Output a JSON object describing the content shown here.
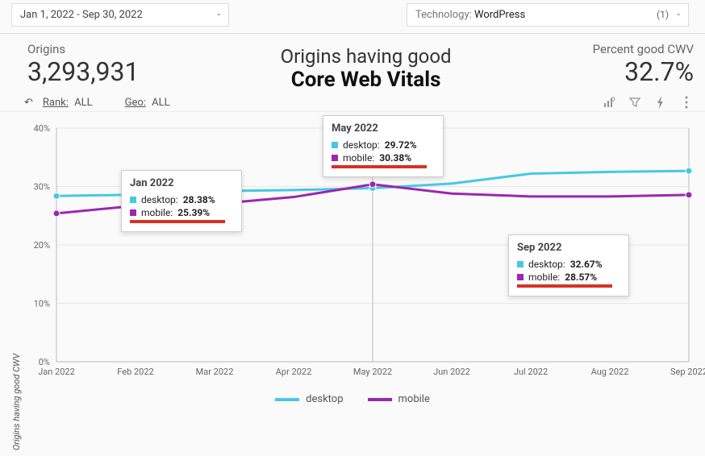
{
  "filters": {
    "date_range": "Jan 1, 2022 - Sep 30, 2022",
    "tech_label": "Technology",
    "tech_value": "WordPress",
    "tech_count": "(1)"
  },
  "header": {
    "origins_label": "Origins",
    "origins_value": "3,293,931",
    "title_line1": "Origins having good",
    "title_line2": "Core Web Vitals",
    "pct_label": "Percent good CWV",
    "pct_value": "32.7%"
  },
  "toolbar": {
    "rank_label": "Rank:",
    "rank_value": "ALL",
    "geo_label": "Geo:",
    "geo_value": "ALL"
  },
  "chart_data": {
    "type": "line",
    "xlabel": "",
    "ylabel": "Origins having good CWV",
    "ylim": [
      0,
      40
    ],
    "yticks": [
      "0%",
      "10%",
      "20%",
      "30%",
      "40%"
    ],
    "categories": [
      "Jan 2022",
      "Feb 2022",
      "Mar 2022",
      "Apr 2022",
      "May 2022",
      "Jun 2022",
      "Jul 2022",
      "Aug 2022",
      "Sep 2022"
    ],
    "series": [
      {
        "name": "desktop",
        "color": "#46c8e4",
        "values": [
          28.38,
          28.6,
          29.2,
          29.4,
          29.72,
          30.5,
          32.2,
          32.5,
          32.67
        ]
      },
      {
        "name": "mobile",
        "color": "#9c27b0",
        "values": [
          25.39,
          26.7,
          27.0,
          28.2,
          30.38,
          28.8,
          28.3,
          28.3,
          28.57
        ]
      }
    ]
  },
  "tooltips": {
    "jan": {
      "title": "Jan 2022",
      "desktop": "28.38%",
      "mobile": "25.39%",
      "desktop_label": "desktop:",
      "mobile_label": "mobile:"
    },
    "may": {
      "title": "May 2022",
      "desktop": "29.72%",
      "mobile": "30.38%",
      "desktop_label": "desktop:",
      "mobile_label": "mobile:"
    },
    "sep": {
      "title": "Sep 2022",
      "desktop": "32.67%",
      "mobile": "28.57%",
      "desktop_label": "desktop:",
      "mobile_label": "mobile:"
    }
  },
  "colors": {
    "desktop": "#46c8e4",
    "mobile": "#9c27b0",
    "highlight": "#d93025"
  }
}
